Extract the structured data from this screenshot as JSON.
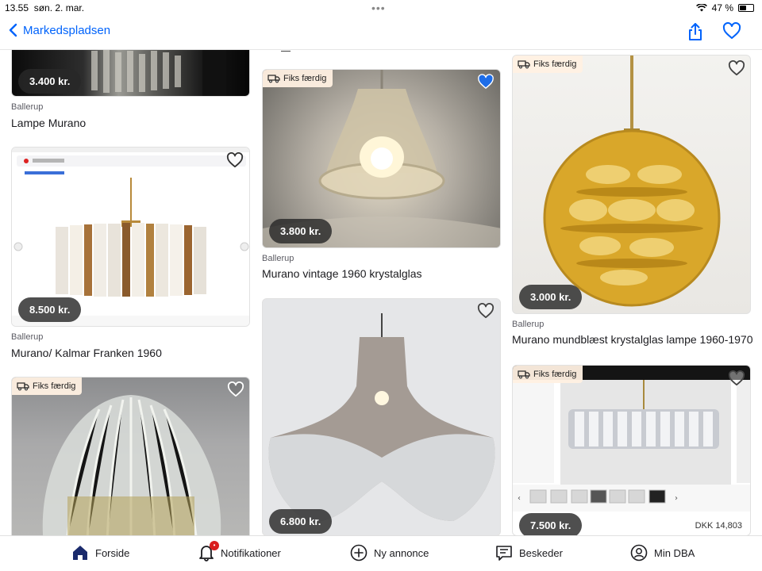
{
  "status_bar": {
    "time": "13.55",
    "date": "søn. 2. mar.",
    "battery": "47 %",
    "battery_level": 0.47
  },
  "nav": {
    "back_label": "Markedspladsen"
  },
  "listings": [
    {
      "price": "3.400 kr.",
      "location": "Ballerup",
      "title": "Lampe Murano"
    },
    {
      "price": "8.500 kr.",
      "location": "Ballerup",
      "title": "Murano/ Kalmar Franken 1960"
    },
    {
      "badge": "Fiks færdig"
    },
    {
      "badge": "Fiks færdig",
      "price": "3.800 kr.",
      "location": "Ballerup",
      "title": "Murano vintage 1960 krystalglas"
    },
    {
      "price": "6.800 kr."
    },
    {
      "badge": "Fiks færdig",
      "price": "3.000 kr.",
      "location": "Ballerup",
      "title": "Murano mundblæst krystalglas lampe 1960-1970"
    },
    {
      "badge": "Fiks færdig",
      "price": "7.500 kr.",
      "overlay_price": "DKK 14,803"
    }
  ],
  "tabs": {
    "home": "Forside",
    "notifications": "Notifikationer",
    "new_ad": "Ny annonce",
    "messages": "Beskeder",
    "my_dba": "Min DBA"
  },
  "colors": {
    "accent": "#0063fb",
    "price_pill": "#2b2b2b",
    "badge_bg": "#fff0e2",
    "notif_dot": "#d91f1f"
  }
}
